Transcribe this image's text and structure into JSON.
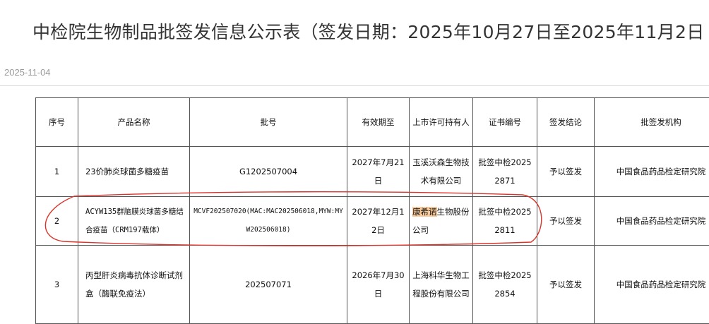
{
  "title": "中检院生物制品批签发信息公示表（签发日期：2025年10月27日至2025年11月2日",
  "date": "2025-11-04",
  "table": {
    "headers": [
      "序号",
      "产品名称",
      "批号",
      "有效期至",
      "上市许可持有人",
      "证书编号",
      "签发结论",
      "批签发机构"
    ],
    "rows": [
      {
        "no": "1",
        "product": "23价肺炎球菌多糖疫苗",
        "batch": "G1202507004",
        "expiry": "2027年7月21日",
        "holder": "玉溪沃森生物技术有限公司",
        "cert": "批签中检20252871",
        "result": "予以签发",
        "agency": "中国食品药品检定研究院"
      },
      {
        "no": "2",
        "product": "ACYW135群脑膜炎球菌多糖结合疫苗（CRM197载体）",
        "batch": "MCVF202507020(MAC:MAC202506018,MYW:MYW202506018)",
        "expiry": "2027年12月12日",
        "holder_highlight": "康希诺",
        "holder_rest": "生物股份公司",
        "cert": "批签中检20252811",
        "result": "予以签发",
        "agency": "中国食品药品检定研究院"
      },
      {
        "no": "3",
        "product": "丙型肝炎病毒抗体诊断试剂盒（酶联免疫法）",
        "batch": "202507071",
        "expiry": "2026年7月30日",
        "holder": "上海科华生物工程股份有限公司",
        "cert": "批签中检20252854",
        "result": "予以签发",
        "agency": "中国食品药品检定研究院"
      }
    ]
  },
  "colors": {
    "highlight": "#f7c99b",
    "annotation": "#d9342b"
  }
}
